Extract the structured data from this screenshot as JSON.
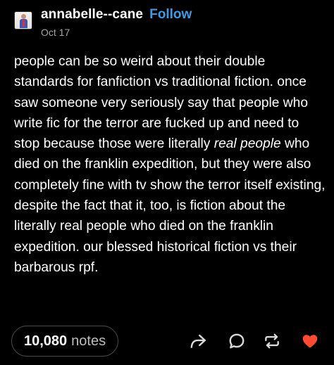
{
  "post": {
    "username": "annabelle--cane",
    "follow_label": "Follow",
    "date": "Oct 17",
    "body": {
      "before_italic": "people can be so weird about their double standards for fanfiction vs traditional fiction. once saw someone very seriously say that people who write fic for the terror are fucked up and need to stop because those were literally ",
      "italic": "real people",
      "after_italic": " who died on the franklin expedition, but they were also completely fine with tv show the terror itself existing, despite the fact that it, too, is fiction about the literally real people who died on the franklin expedition. our blessed historical fiction vs their barbarous rpf."
    }
  },
  "footer": {
    "notes_count": "10,080",
    "notes_label": "notes",
    "actions": [
      {
        "name": "share",
        "icon": "share-arrow-icon"
      },
      {
        "name": "reply",
        "icon": "reply-bubble-icon"
      },
      {
        "name": "reblog",
        "icon": "reblog-icon"
      },
      {
        "name": "like",
        "icon": "heart-icon"
      }
    ]
  },
  "colors": {
    "background": "#000000",
    "text": "#ffffff",
    "follow": "#3f9ae6",
    "muted": "#a6a6a6",
    "like": "#ff4930"
  }
}
